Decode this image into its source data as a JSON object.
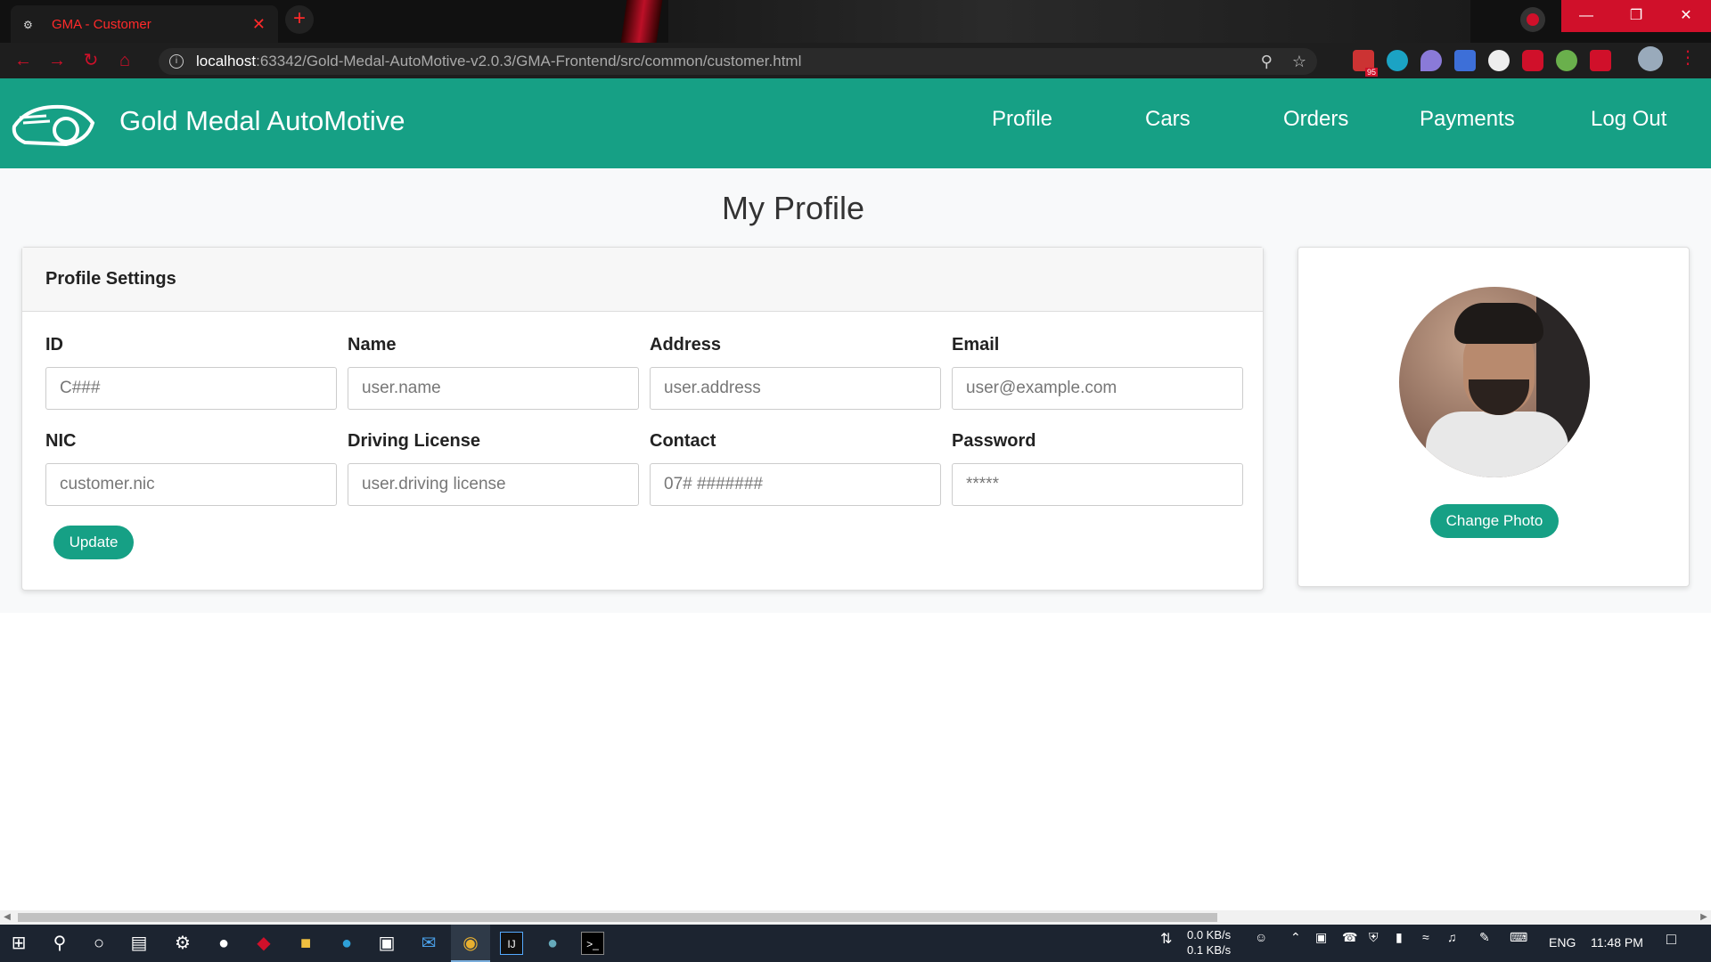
{
  "browser": {
    "tab_title": "GMA - Customer",
    "url_host": "localhost",
    "url_path": ":63342/Gold-Medal-AutoMotive-v2.0.3/GMA-Frontend/src/common/customer.html",
    "ext_badge": "95"
  },
  "navbar": {
    "brand": "Gold Medal AutoMotive",
    "links": [
      "Profile",
      "Cars",
      "Orders",
      "Payments",
      "Log Out"
    ]
  },
  "page": {
    "title": "My Profile",
    "card_header": "Profile Settings",
    "fields": [
      {
        "label": "ID",
        "placeholder": "C###"
      },
      {
        "label": "Name",
        "placeholder": "user.name"
      },
      {
        "label": "Address",
        "placeholder": "user.address"
      },
      {
        "label": "Email",
        "placeholder": "user@example.com"
      },
      {
        "label": "NIC",
        "placeholder": "customer.nic"
      },
      {
        "label": "Driving License",
        "placeholder": "user.driving license"
      },
      {
        "label": "Contact",
        "placeholder": "07# #######"
      },
      {
        "label": "Password",
        "placeholder": "*****"
      }
    ],
    "update_button": "Update",
    "change_photo_button": "Change Photo"
  },
  "taskbar": {
    "net_down": "0.0 KB/s",
    "net_up": "0.1 KB/s",
    "lang": "ENG",
    "time": "11:48 PM"
  },
  "colors": {
    "accent": "#16a085",
    "browser_accent": "#d0102a"
  }
}
